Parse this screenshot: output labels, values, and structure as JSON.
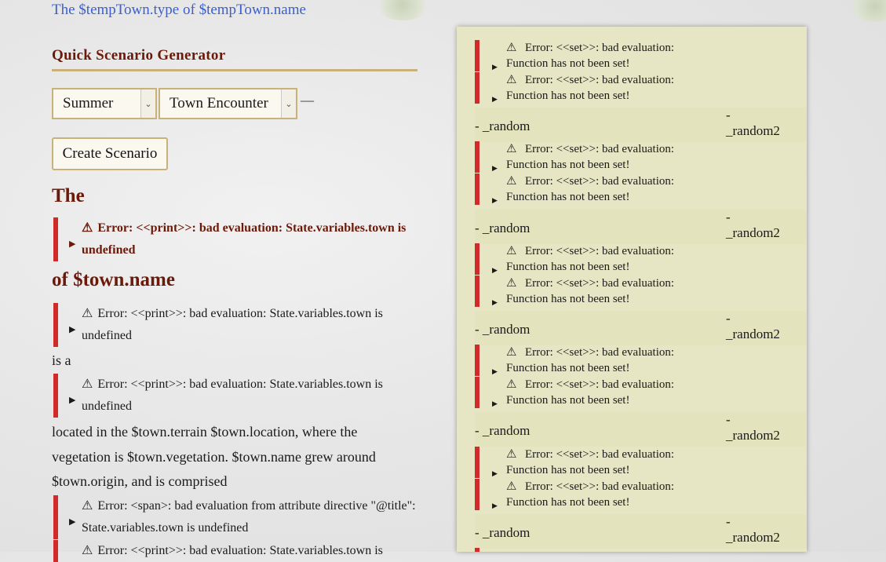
{
  "top_link": "The $tempTown.type of $tempTown.name",
  "generator": {
    "heading": "Quick Scenario Generator",
    "season_select": "Summer",
    "type_select": "Town Encounter",
    "dash": "—",
    "create_button": "Create Scenario"
  },
  "story": {
    "the": "The",
    "of_name": "of $town.name",
    "is_a": "is a",
    "located": "located in the $town.terrain $town.location, where the vegetation is $town.vegetation. $town.name grew around $town.origin, and is comprised"
  },
  "errors": {
    "print_town": "Error: <<print>>: bad evaluation: State.variables.town is undefined",
    "span_title": "Error: <span>: bad evaluation from attribute directive \"@title\": State.variables.town is undefined",
    "print_town_partial": "Error: <<print>>: bad evaluation: State.variables.town is",
    "set_line1": "Error: <<set>>: bad evaluation:",
    "set_line2": "Function has not been set!"
  },
  "panel": {
    "random": "- _random",
    "random2_dash": "-",
    "random2": "_random2"
  },
  "icons": {
    "warning": "warning-icon",
    "disclosure": "triangle-right-icon",
    "chevron": "chevron-down-icon"
  },
  "colors": {
    "error_bar": "#d02a2a",
    "heading": "#6b1a0a",
    "link": "#3a5fd0",
    "panel_bg": "#e7e6c4",
    "border_gold": "#c9b27a"
  }
}
